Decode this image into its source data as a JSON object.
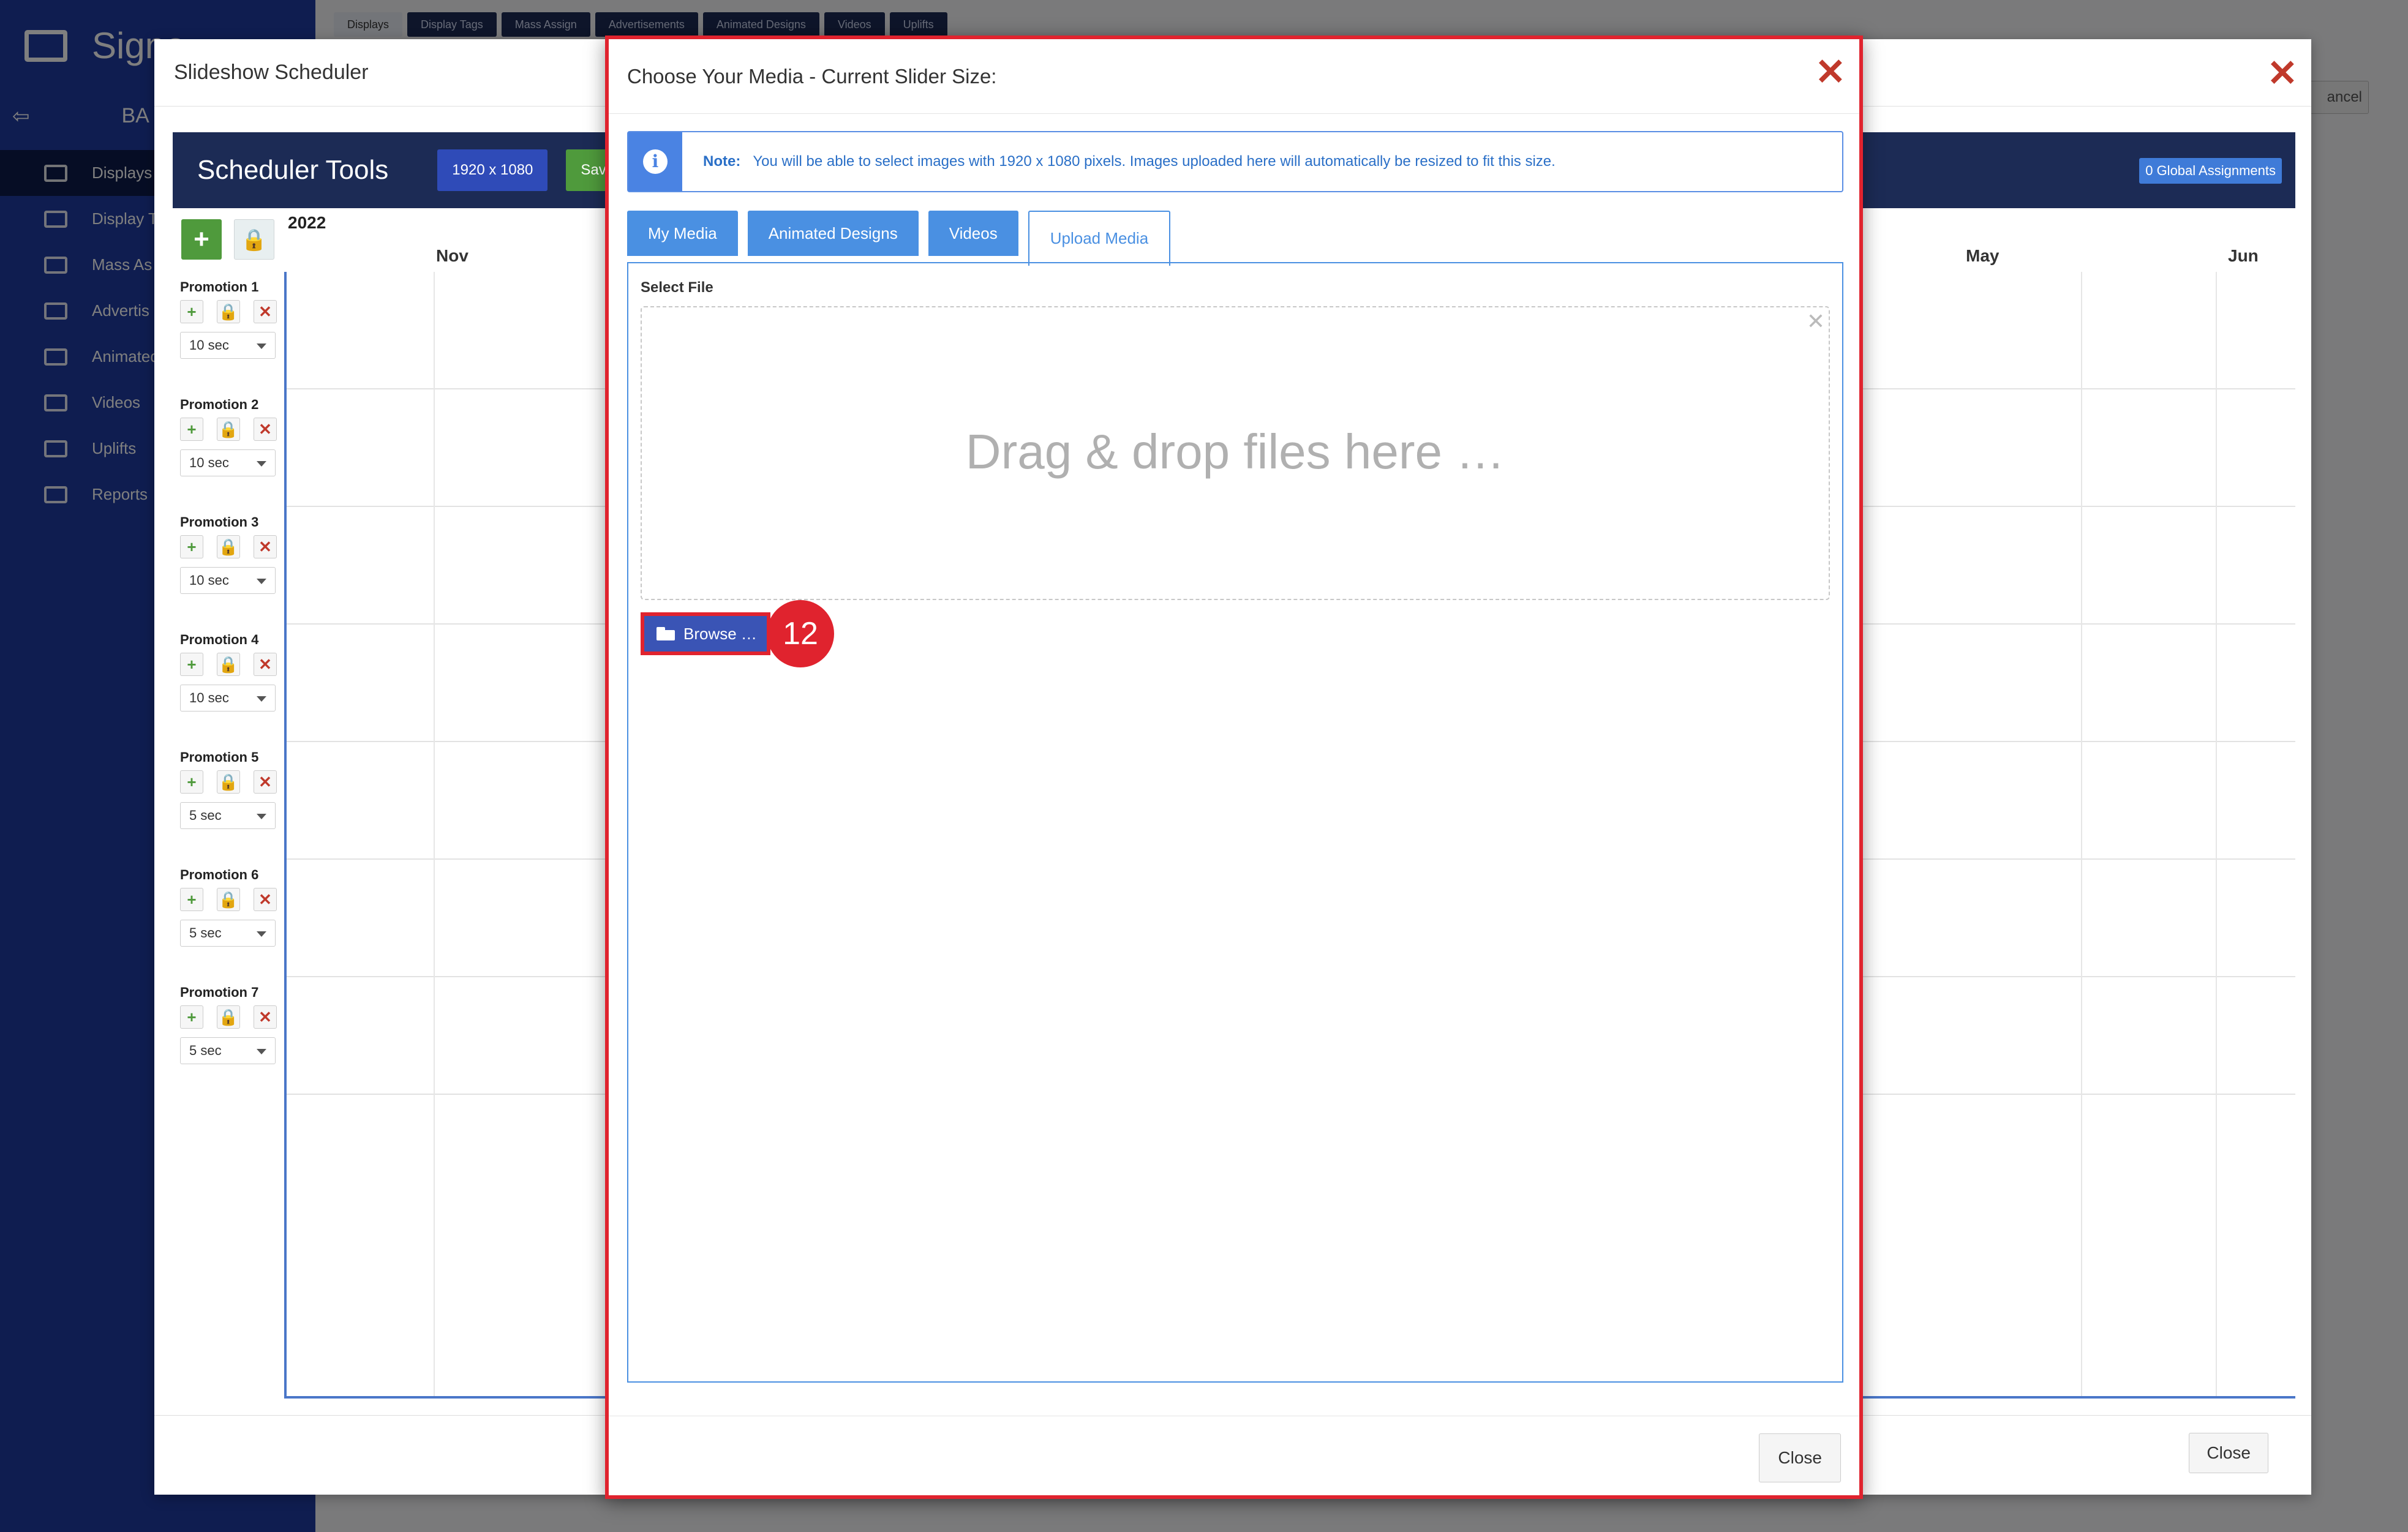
{
  "background": {
    "brand": "Signa",
    "back_label": "BA",
    "topnav": [
      "Displays",
      "Display Tags",
      "Mass Assign",
      "Advertisements",
      "Animated Designs",
      "Videos",
      "Uplifts"
    ],
    "sidebar": [
      "Displays",
      "Display T",
      "Mass As",
      "Advertis",
      "Animated",
      "Videos",
      "Uplifts",
      "Reports"
    ],
    "cancel_label": "ancel"
  },
  "scheduler": {
    "title": "Slideshow Scheduler",
    "tools_title": "Scheduler Tools",
    "resolution": "1920 x 1080",
    "save_label": "Save",
    "global_assignments": "0 Global Assignments",
    "year": "2022",
    "months": [
      "Nov",
      "May",
      "Jun"
    ],
    "promotions": [
      {
        "name": "Promotion 1",
        "duration": "10 sec"
      },
      {
        "name": "Promotion 2",
        "duration": "10 sec"
      },
      {
        "name": "Promotion 3",
        "duration": "10 sec"
      },
      {
        "name": "Promotion 4",
        "duration": "10 sec"
      },
      {
        "name": "Promotion 5",
        "duration": "5 sec"
      },
      {
        "name": "Promotion 6",
        "duration": "5 sec"
      },
      {
        "name": "Promotion 7",
        "duration": "5 sec"
      }
    ],
    "close_label": "Close"
  },
  "media_modal": {
    "title": "Choose Your Media - Current Slider Size:",
    "note_label": "Note:",
    "note_text": "You will be able to select images with 1920 x 1080 pixels. Images uploaded here will automatically be resized to fit this size.",
    "tabs": [
      "My Media",
      "Animated Designs",
      "Videos",
      "Upload Media"
    ],
    "active_tab": "Upload Media",
    "select_file_label": "Select File",
    "dropzone_text": "Drag & drop files here …",
    "browse_label": "Browse …",
    "step_number": "12",
    "close_label": "Close"
  },
  "colors": {
    "highlight": "#e0232e",
    "tab_blue": "#4a90e2",
    "navy": "#1c2b55"
  }
}
